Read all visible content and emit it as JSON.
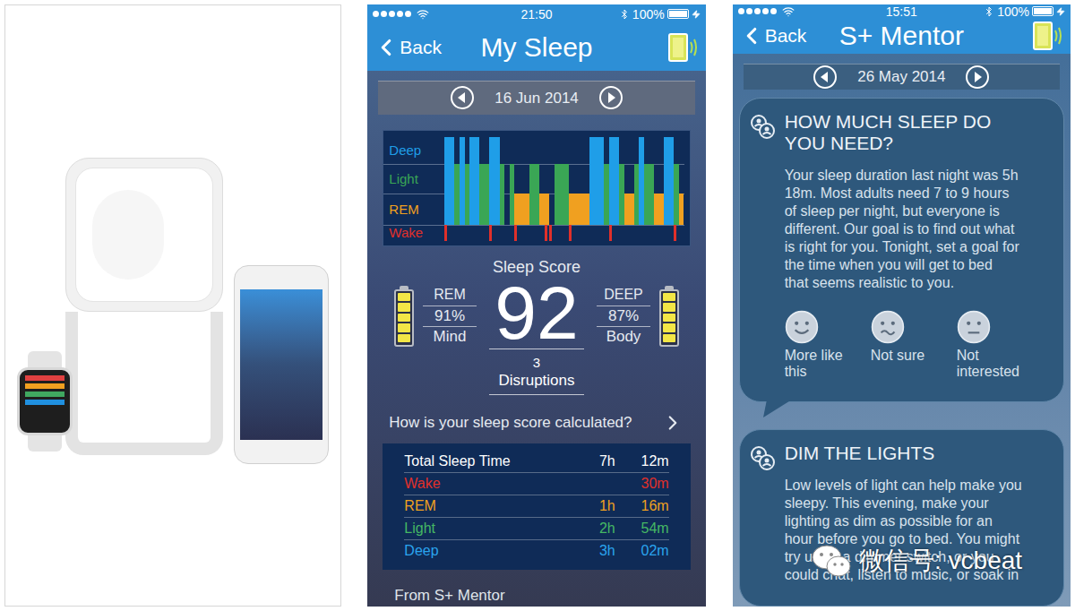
{
  "sleep_screen": {
    "status_bar": {
      "signal_bars": 5,
      "time": "21:50",
      "battery": "100%",
      "battery_level": 1,
      "charging": true
    },
    "nav": {
      "back": "Back",
      "title": "My Sleep"
    },
    "date_nav": {
      "date": "16 Jun 2014"
    },
    "hypnogram": {
      "stages": [
        {
          "label": "Deep",
          "color": "#1f9ee8"
        },
        {
          "label": "Light",
          "color": "#3aa655"
        },
        {
          "label": "REM",
          "color": "#f0a020"
        },
        {
          "label": "Wake",
          "color": "#e0302a"
        }
      ],
      "series": [
        {
          "name": "stage",
          "values": [
            3,
            3,
            2,
            3,
            2,
            3,
            3,
            2,
            2,
            3,
            3,
            2,
            0,
            2,
            1,
            1,
            1,
            2,
            2,
            1,
            1,
            0,
            2,
            2,
            2,
            1,
            1,
            1,
            1,
            3,
            3,
            3,
            2,
            3,
            3,
            2,
            1,
            1,
            2,
            3,
            2,
            2,
            1,
            1,
            3,
            3,
            2,
            1
          ]
        },
        {
          "name": "wake",
          "values": [
            1,
            0,
            0,
            0,
            0,
            0,
            0,
            0,
            0,
            1,
            0,
            0,
            0,
            0,
            1,
            0,
            0,
            0,
            0,
            0,
            1,
            1,
            0,
            0,
            0,
            1,
            0,
            0,
            0,
            0,
            0,
            0,
            0,
            1,
            0,
            0,
            0,
            0,
            0,
            0,
            0,
            0,
            0,
            0,
            0,
            0,
            1,
            0
          ]
        }
      ]
    },
    "score": {
      "title": "Sleep Score",
      "value": "92",
      "left": {
        "label": "REM",
        "percent": "91%",
        "caption": "Mind",
        "level": 0.91
      },
      "right": {
        "label": "DEEP",
        "percent": "87%",
        "caption": "Body",
        "level": 0.87
      },
      "disruptions": {
        "count": "3",
        "label": "Disruptions"
      }
    },
    "score_link": "How is your sleep score calculated?",
    "summary": {
      "rows": [
        {
          "label": "Total Sleep Time",
          "hours": "7h",
          "minutes": "12m",
          "color": "#ffffff"
        },
        {
          "label": "Wake",
          "hours": "",
          "minutes": "30m",
          "color": "#e0302a"
        },
        {
          "label": "REM",
          "hours": "1h",
          "minutes": "16m",
          "color": "#f0a020"
        },
        {
          "label": "Light",
          "hours": "2h",
          "minutes": "54m",
          "color": "#45b864"
        },
        {
          "label": "Deep",
          "hours": "3h",
          "minutes": "02m",
          "color": "#2aa4ee"
        }
      ]
    },
    "footer": "From S+ Mentor"
  },
  "mentor_screen": {
    "status_bar": {
      "signal_bars": 5,
      "time": "15:51",
      "battery": "100%",
      "battery_level": 1,
      "charging": true
    },
    "nav": {
      "back": "Back",
      "title": "S+ Mentor"
    },
    "date_nav": {
      "date": "26 May 2014"
    },
    "cards": [
      {
        "title": "HOW MUCH SLEEP DO YOU NEED?",
        "body_lines": [
          "Your sleep duration last night was 5h",
          "18m. Most adults need 7 to 9 hours",
          "of sleep per night, but everyone is",
          "different. Our goal is to find out what",
          "is right for you. Tonight, set a goal for",
          "the time when you will get to bed",
          "that seems realistic to you."
        ],
        "options": [
          {
            "label": "More like this",
            "kind": "happy"
          },
          {
            "label": "Not sure",
            "kind": "unsure"
          },
          {
            "label": "Not interested",
            "kind": "neutral"
          }
        ]
      },
      {
        "title": "DIM THE LIGHTS",
        "body_lines": [
          "Low levels of light can help make you",
          "sleepy. This evening, make your",
          "lighting as dim as possible for an",
          "hour before you go to bed. You might",
          "try using a dimmer switch, or you",
          "could chat, listen to music, or soak in"
        ],
        "options": []
      }
    ]
  },
  "watermark": {
    "text": "微信号: vcbeat"
  }
}
